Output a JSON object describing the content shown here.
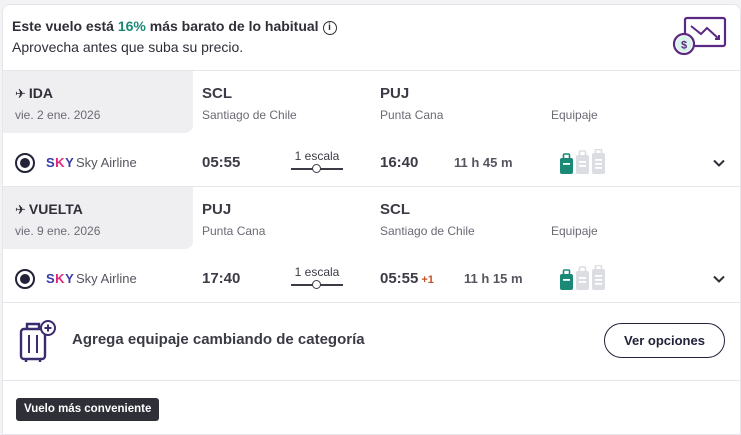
{
  "promo": {
    "prefix": "Este vuelo está ",
    "percent": "16%",
    "suffix": " más barato de lo habitual",
    "info_glyph": "i",
    "subtitle": "Aprovecha antes que suba su precio.",
    "icon": "price-drop-icon"
  },
  "outbound": {
    "direction": "IDA",
    "date": "vie. 2 ene. 2026",
    "origin_code": "SCL",
    "origin_city": "Santiago de Chile",
    "dest_code": "PUJ",
    "dest_city": "Punta Cana",
    "equipment_label": "Equipaje",
    "airline_logo_s": "S",
    "airline_logo_k": "K",
    "airline_logo_y": "Y",
    "airline": "Sky Airline",
    "depart_time": "05:55",
    "stops": "1 escala",
    "arrive_time": "16:40",
    "day_offset": "",
    "duration": "11 h 45 m"
  },
  "return": {
    "direction": "VUELTA",
    "date": "vie. 9 ene. 2026",
    "origin_code": "PUJ",
    "origin_city": "Punta Cana",
    "dest_code": "SCL",
    "dest_city": "Santiago de Chile",
    "equipment_label": "Equipaje",
    "airline_logo_s": "S",
    "airline_logo_k": "K",
    "airline_logo_y": "Y",
    "airline": "Sky Airline",
    "depart_time": "17:40",
    "stops": "1 escala",
    "arrive_time": "05:55",
    "day_offset": "+1",
    "duration": "11 h 15 m"
  },
  "extra_baggage": {
    "text": "Agrega equipaje cambiando de categoría",
    "button": "Ver opciones"
  },
  "badge": "Vuelo más conveniente",
  "colors": {
    "accent_green": "#1a8a76",
    "brand_purple": "#3a3aa8",
    "brand_pink": "#e0267a",
    "dark": "#22223a"
  }
}
